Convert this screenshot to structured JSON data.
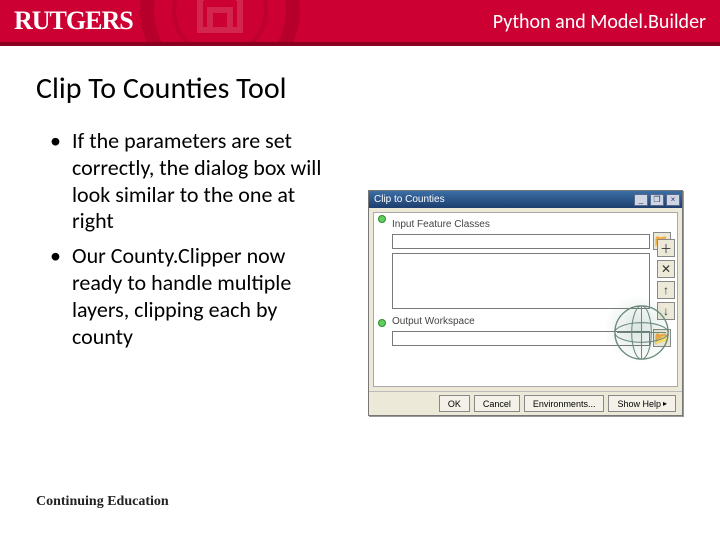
{
  "header": {
    "brand": "RUTGERS",
    "course": "Python and Model.Builder"
  },
  "slide": {
    "title": "Clip To Counties Tool",
    "bullets": [
      "If the parameters are set correctly, the dialog box will look similar to the one at right",
      "Our County.Clipper now ready to handle multiple layers, clipping each by county"
    ],
    "footer": "Continuing Education"
  },
  "dialog": {
    "title": "Clip to Counties",
    "field1_label": "Input Feature Classes",
    "field2_label": "Output Workspace",
    "buttons": {
      "ok": "OK",
      "cancel": "Cancel",
      "env": "Environments...",
      "help": "Show Help"
    },
    "win": {
      "min": "_",
      "max": "❐",
      "close": "×"
    },
    "icons": {
      "browse": "📂",
      "add": "＋",
      "remove": "✕",
      "up": "↑",
      "down": "↓"
    }
  }
}
